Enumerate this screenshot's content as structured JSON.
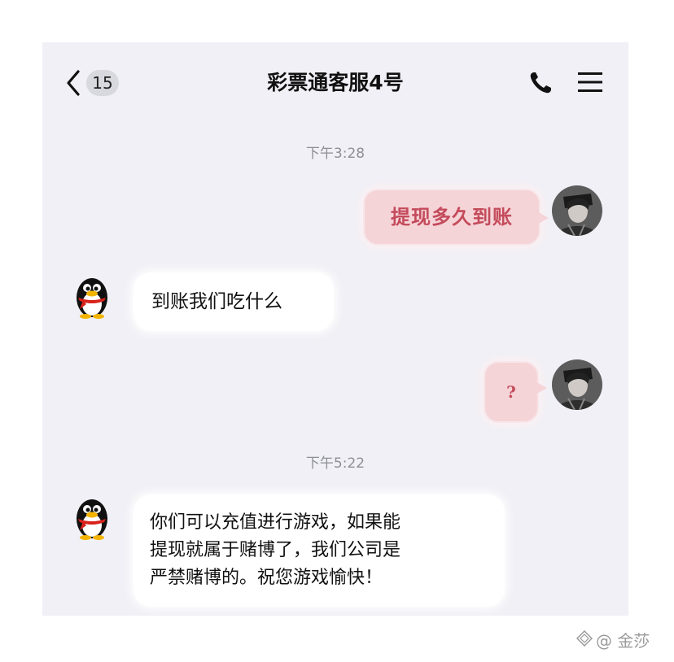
{
  "header": {
    "unread_count": "15",
    "title": "彩票通客服4号"
  },
  "messages": {
    "time1": "下午3:28",
    "m1": "提现多久到账",
    "m2": "到账我们吃什么",
    "m3": "?",
    "time2": "下午5:22",
    "m4_line1": "你们可以充值进行游戏，如果能",
    "m4_line2": "提现就属于赌博了，我们公司是",
    "m4_line3": "严禁赌博的。祝您游戏愉快！"
  },
  "watermark": {
    "text": "@ 金莎"
  },
  "icons": [
    "back-chevron-icon",
    "phone-icon",
    "menu-icon",
    "qq-penguin-icon",
    "user-avatar-icon",
    "watermark-icon"
  ],
  "colors": {
    "chat_bg": "#f0f0f6",
    "sent_bubble": "#f5d4d8",
    "sent_text": "#c44b5b",
    "received_bubble": "#ffffff"
  }
}
